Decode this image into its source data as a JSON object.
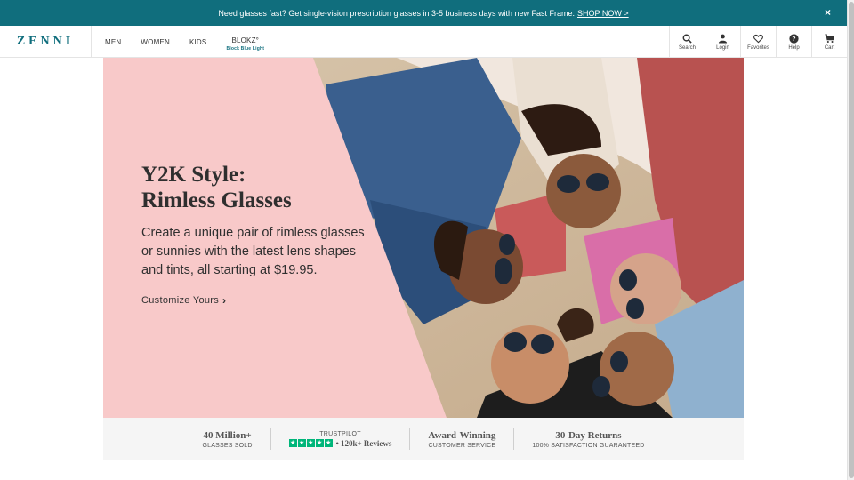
{
  "promo": {
    "text": "Need glasses fast? Get single-vision prescription glasses in 3-5 business days with new Fast Frame.",
    "cta": "SHOP NOW >",
    "close": "×"
  },
  "header": {
    "logo": "ZENNI",
    "nav": [
      {
        "label": "MEN"
      },
      {
        "label": "WOMEN"
      },
      {
        "label": "KIDS"
      }
    ],
    "blokz": {
      "label": "BLOKZ°",
      "sub": "Block Blue Light"
    },
    "utils": [
      {
        "label": "Search",
        "icon": "search-icon"
      },
      {
        "label": "Login",
        "icon": "user-icon"
      },
      {
        "label": "Favorites",
        "icon": "heart-icon"
      },
      {
        "label": "Help",
        "icon": "help-icon"
      },
      {
        "label": "Cart",
        "icon": "cart-icon"
      }
    ]
  },
  "hero": {
    "title_line1": "Y2K Style:",
    "title_line2": "Rimless Glasses",
    "body": "Create a unique pair of rimless glasses or sunnies with the latest lens shapes and tints, all starting at $19.95.",
    "cta": "Customize Yours",
    "cta_icon": "chevron-right-icon"
  },
  "stats": {
    "sold_big": "40 Million+",
    "sold_small": "GLASSES SOLD",
    "trustpilot_label": "TRUSTPILOT",
    "trustpilot_reviews": "• 120k+ Reviews",
    "trustpilot_stars": 5,
    "award_big": "Award-Winning",
    "award_small": "CUSTOMER SERVICE",
    "returns_big": "30-Day Returns",
    "returns_small": "100% SATISFACTION GUARANTEED"
  },
  "colors": {
    "brand": "#106e7d",
    "hero_pink": "#f8c9c9",
    "trustpilot_green": "#00b67a"
  }
}
